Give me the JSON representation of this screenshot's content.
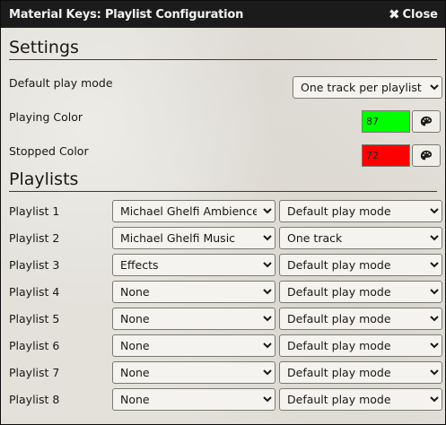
{
  "window": {
    "title": "Material Keys: Playlist Configuration",
    "close_label": "Close"
  },
  "settings": {
    "heading": "Settings",
    "default_play_mode": {
      "label": "Default play mode",
      "value": "One track per playlist"
    },
    "playing_color": {
      "label": "Playing Color",
      "value": "87",
      "color": "#00ff00"
    },
    "stopped_color": {
      "label": "Stopped Color",
      "value": "72",
      "color": "#ff0000"
    }
  },
  "playlists": {
    "heading": "Playlists",
    "rows": [
      {
        "label": "Playlist 1",
        "playlist": "Michael Ghelfi Ambience",
        "mode": "Default play mode"
      },
      {
        "label": "Playlist 2",
        "playlist": "Michael Ghelfi Music",
        "mode": "One track"
      },
      {
        "label": "Playlist 3",
        "playlist": "Effects",
        "mode": "Default play mode"
      },
      {
        "label": "Playlist 4",
        "playlist": "None",
        "mode": "Default play mode"
      },
      {
        "label": "Playlist 5",
        "playlist": "None",
        "mode": "Default play mode"
      },
      {
        "label": "Playlist 6",
        "playlist": "None",
        "mode": "Default play mode"
      },
      {
        "label": "Playlist 7",
        "playlist": "None",
        "mode": "Default play mode"
      },
      {
        "label": "Playlist 8",
        "playlist": "None",
        "mode": "Default play mode"
      }
    ]
  },
  "icons": {
    "close": "close-icon",
    "palette": "palette-icon"
  }
}
